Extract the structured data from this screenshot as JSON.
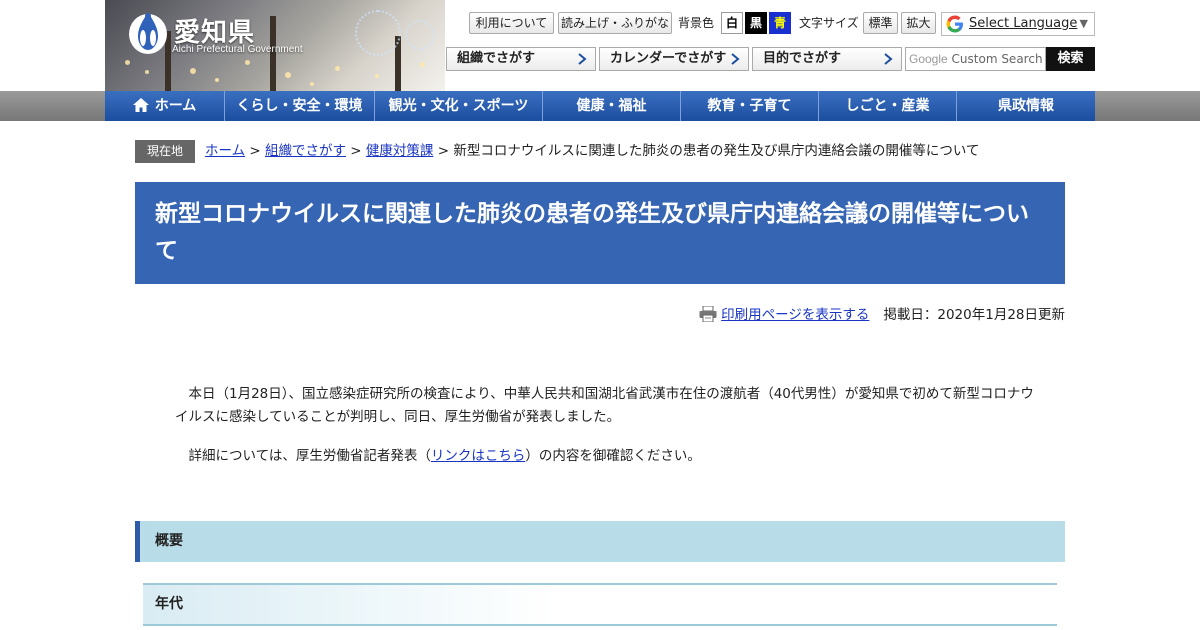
{
  "header": {
    "logo_name": "愛知県",
    "logo_sub": "Aichi Prefectural Government",
    "tools": {
      "usage": "利用について",
      "read_aloud": "読み上げ・ふりがな",
      "bg_color_label": "背景色",
      "bg_white": "白",
      "bg_black": "黒",
      "bg_blue": "青",
      "font_size_label": "文字サイズ",
      "font_standard": "標準",
      "font_large": "拡大"
    },
    "language": {
      "label": "Select Language",
      "arrow": "▼"
    },
    "search_tabs": [
      "組織でさがす",
      "カレンダーでさがす",
      "目的でさがす"
    ],
    "search": {
      "brand": "Google",
      "placeholder": "Custom Search",
      "button": "検索"
    }
  },
  "nav": {
    "items": [
      "ホーム",
      "くらし・安全・環境",
      "観光・文化・スポーツ",
      "健康・福祉",
      "教育・子育て",
      "しごと・産業",
      "県政情報"
    ]
  },
  "breadcrumb": {
    "label": "現在地",
    "links": [
      "ホーム",
      "組織でさがす",
      "健康対策課"
    ],
    "separator": " > ",
    "current": "新型コロナウイルスに関連した肺炎の患者の発生及び県庁内連絡会議の開催等について"
  },
  "page": {
    "title": "新型コロナウイルスに関連した肺炎の患者の発生及び県庁内連絡会議の開催等について",
    "print_link": "印刷用ページを表示する",
    "updated": "掲載日：2020年1月28日更新",
    "para1": "本日（1月28日）、国立感染症研究所の検査により、中華人民共和国湖北省武漢市在住の渡航者（40代男性）が愛知県で初めて新型コロナウイルスに感染していることが判明し、同日、厚生労働省が発表しました。",
    "para2_before": "詳細については、厚生労働省記者発表（",
    "para2_link": "リンクはこちら",
    "para2_after": "）の内容を御確認ください。",
    "section_overview": "概要",
    "section_age": "年代"
  },
  "colors": {
    "nav_blue": "#1c4ea0",
    "title_blue": "#3665b3",
    "link": "#1a35c4",
    "section_bg": "#b8dde8"
  }
}
